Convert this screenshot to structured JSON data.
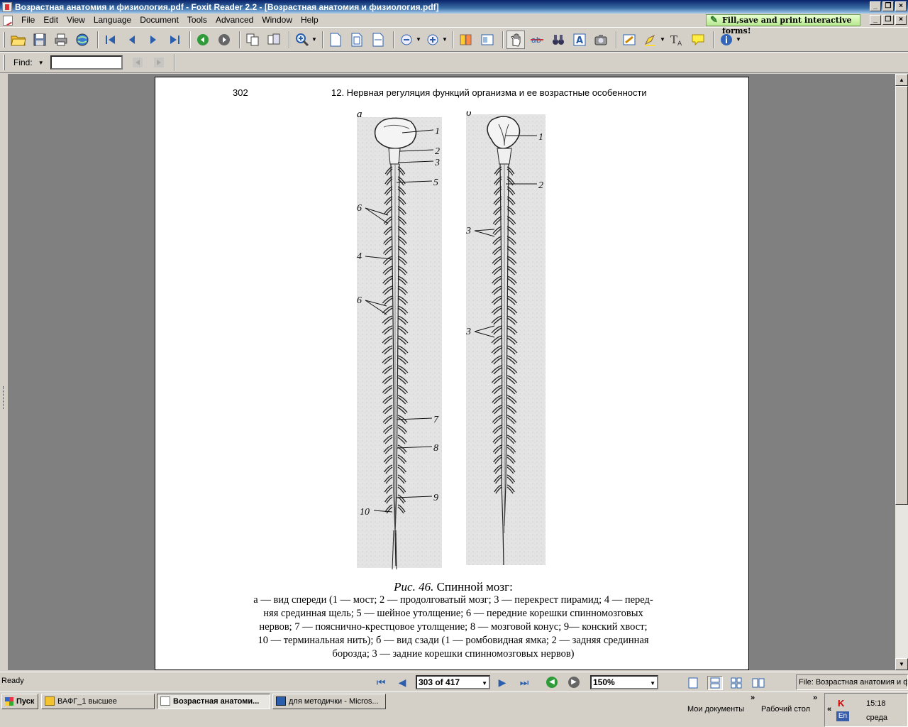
{
  "window": {
    "title": "Возрастная анатомия и физиология.pdf - Foxit Reader 2.2 - [Возрастная анатомия и физиология.pdf]"
  },
  "menu": [
    "File",
    "Edit",
    "View",
    "Language",
    "Document",
    "Tools",
    "Advanced",
    "Window",
    "Help"
  ],
  "fill_banner": "Fill,save and print interactive forms!",
  "find": {
    "label": "Find:",
    "value": ""
  },
  "document": {
    "page_number": "302",
    "running_header": "12. Нервная регуляция функций организма и ее возрастные особенности",
    "figure": {
      "panel_labels": [
        "а",
        "б"
      ],
      "callouts_a": [
        "1",
        "2",
        "3",
        "5",
        "6",
        "4",
        "6",
        "7",
        "8",
        "9",
        "10"
      ],
      "callouts_b": [
        "1",
        "2",
        "3",
        "3"
      ]
    },
    "caption": {
      "title_italic": "Рис. 46.",
      "title": " Спинной мозг:",
      "lines": [
        "а — вид спереди (1 — мост; 2 — продолговатый мозг; 3 — перекрест пирамид; 4 — перед-",
        "няя срединная щель; 5 — шейное утолщение; 6 — передние корешки спинномозговых",
        "нервов; 7 — пояснично-крестцовое утолщение; 8 — мозговой конус; 9— конский хвост;",
        "10 — терминальная нить); б — вид сзади (1 — ромбовидная ямка; 2 — задняя срединная",
        "борозда; 3 — задние корешки спинномозговых нервов)"
      ]
    }
  },
  "status": {
    "ready": "Ready",
    "page": "303 of 417",
    "zoom": "150%",
    "file": "File: Возрастная анатомия и физиология.pdf"
  },
  "taskbar": {
    "start": "Пуск",
    "tasks": [
      {
        "label": "ВАФГ_1 высшее",
        "active": false
      },
      {
        "label": "Возрастная анатоми...",
        "active": true
      },
      {
        "label": "для методички - Micros...",
        "active": false
      }
    ],
    "quick_links": [
      "Мои документы",
      "Рабочий стол"
    ],
    "tray": {
      "time": "15:18",
      "day": "среда",
      "lang": "En"
    }
  },
  "colors": {
    "title_bar": "#0a246a",
    "doc_background": "#808080",
    "chrome": "#d4d0c8"
  }
}
